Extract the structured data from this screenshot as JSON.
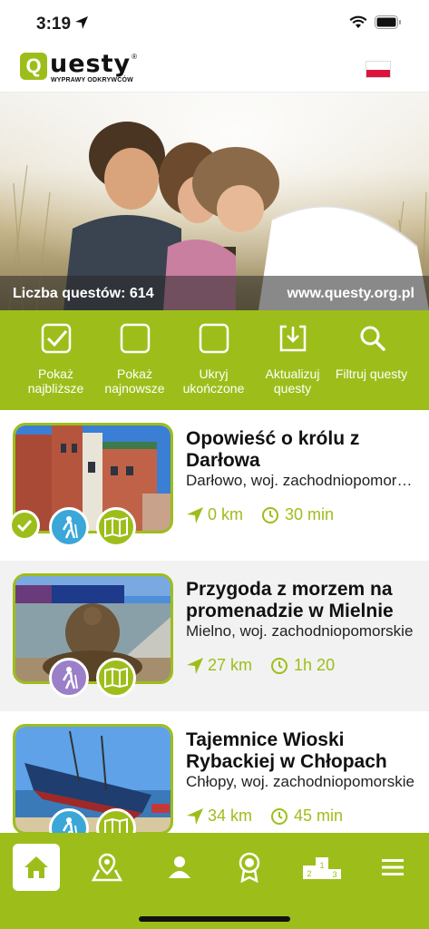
{
  "status_bar": {
    "time": "3:19"
  },
  "header": {
    "logo_text": "uesty",
    "logo_tagline": "WYPRAWY ODKRYWCÓW",
    "language_flag": "pl"
  },
  "hero": {
    "quest_count": "Liczba questów: 614",
    "url": "www.questy.org.pl"
  },
  "actions": [
    {
      "label": "Pokaż najbliższe",
      "icon": "checkbox-checked-icon"
    },
    {
      "label": "Pokaż najnowsze",
      "icon": "checkbox-icon"
    },
    {
      "label": "Ukryj ukończone",
      "icon": "checkbox-icon"
    },
    {
      "label": "Aktualizuj questy",
      "icon": "download-icon"
    },
    {
      "label": "Filtruj questy",
      "icon": "search-icon"
    }
  ],
  "quests": [
    {
      "title": "Opowieść o królu z Darłowa",
      "location": "Darłowo, woj. zachodniopomorskie",
      "distance": "0 km",
      "duration": "30 min",
      "completed": true,
      "type_badge": "hiking"
    },
    {
      "title": "Przygoda z morzem na promenadzie w Mielnie",
      "location": "Mielno, woj. zachodniopomorskie",
      "distance": "27 km",
      "duration": "1h 20",
      "completed": false,
      "type_badge": "hiking"
    },
    {
      "title": "Tajemnice Wioski Rybackiej w Chłopach",
      "location": "Chłopy, woj. zachodniopomorskie",
      "distance": "34 km",
      "duration": "45 min",
      "completed": false,
      "type_badge": "hiking"
    }
  ],
  "tabs": [
    {
      "name": "home",
      "active": true
    },
    {
      "name": "map"
    },
    {
      "name": "profile"
    },
    {
      "name": "badges"
    },
    {
      "name": "ranking"
    },
    {
      "name": "menu"
    }
  ],
  "colors": {
    "brand_green": "#9dbe1a",
    "hike_blue": "#3aa7d8",
    "hike_purple": "#9b7fc8"
  }
}
